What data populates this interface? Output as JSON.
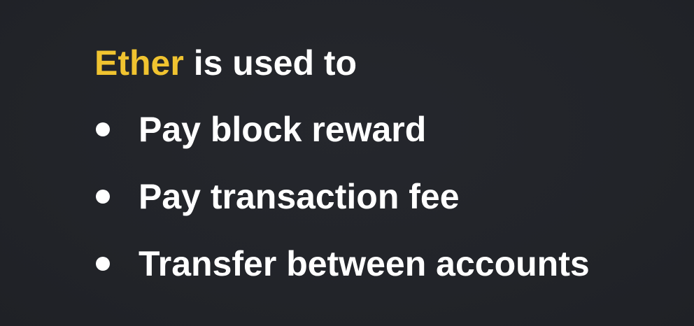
{
  "colors": {
    "background": "#22242a",
    "accent": "#f0c330",
    "text": "#ffffff"
  },
  "heading": {
    "accent_word": "Ether",
    "rest": " is used to"
  },
  "bullets": [
    {
      "label": "Pay block reward"
    },
    {
      "label": "Pay transaction fee"
    },
    {
      "label": "Transfer between accounts"
    }
  ]
}
